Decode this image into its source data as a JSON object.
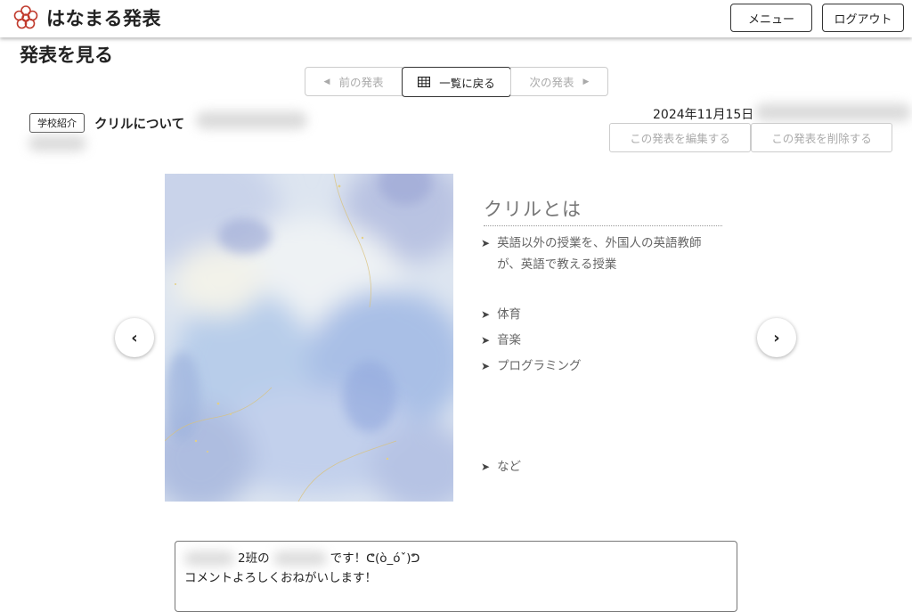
{
  "header": {
    "app_title": "はなまる発表",
    "menu_label": "メニュー",
    "logout_label": "ログアウト",
    "logo_icon": "flower-icon",
    "logo_color": "#c0392b"
  },
  "page_title": "発表を見る",
  "nav": {
    "prev_label": "前の発表",
    "list_label": "一覧に戻る",
    "next_label": "次の発表"
  },
  "presentation": {
    "category": "学校紹介",
    "title": "クリルについて",
    "date": "2024年11月15日",
    "edit_label": "この発表を編集する",
    "delete_label": "この発表を削除する"
  },
  "slide": {
    "heading": "クリルとは",
    "bullets": [
      "英語以外の授業を、外国人の英語教師が、英語で教える授業",
      "体育",
      "音楽",
      "プログラミング",
      "など"
    ]
  },
  "comment": {
    "line1_part1": "2班の",
    "line1_part2": "です！ᕦ(ò_óˇ)ᕤ",
    "line2": "コメントよろしくおねがいします！"
  }
}
